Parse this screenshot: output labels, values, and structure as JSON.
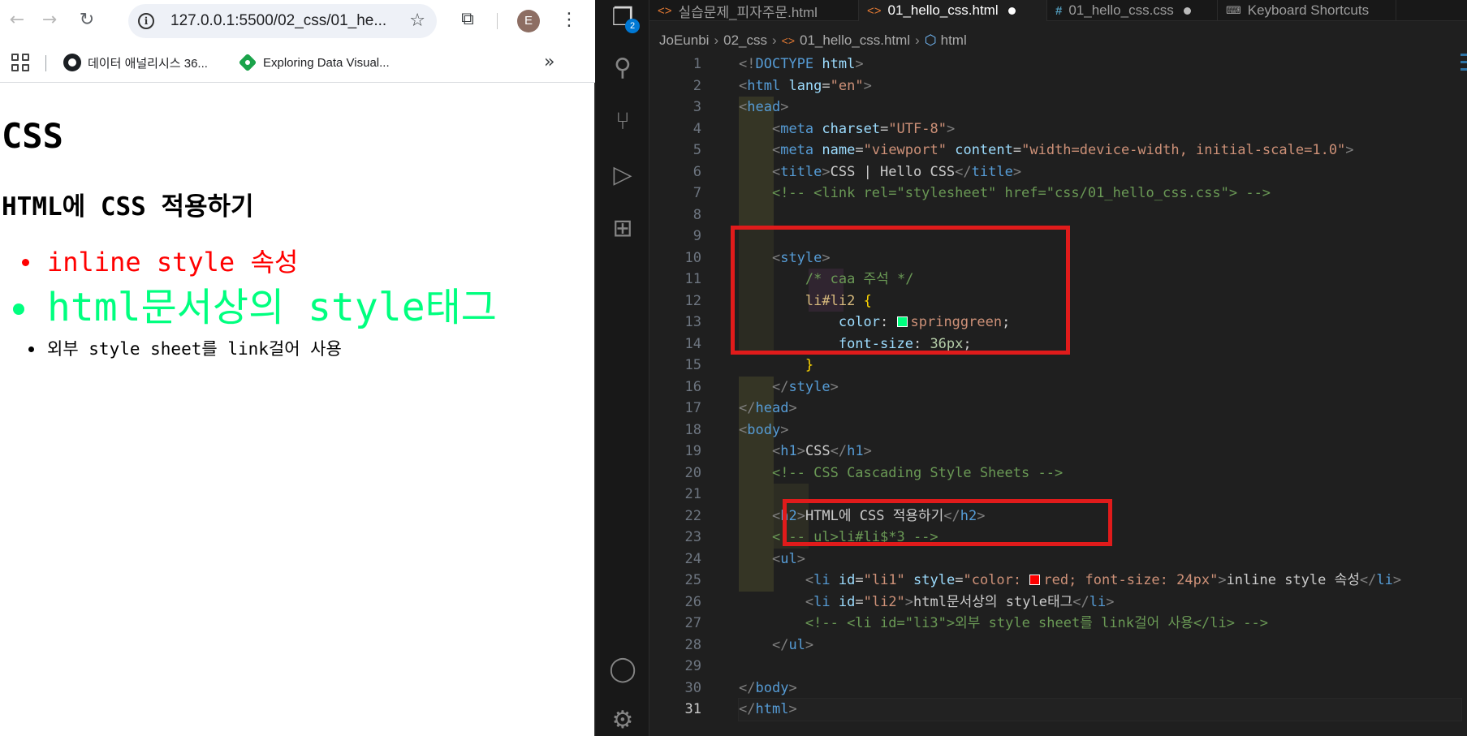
{
  "browser": {
    "url": "127.0.0.1:5500/02_css/01_he...",
    "avatar_letter": "E",
    "bookmarks": [
      {
        "label": "데이터 애널리시스 36...",
        "icon": "github-icon"
      },
      {
        "label": "Exploring Data Visual...",
        "icon": "datavis-icon"
      }
    ],
    "page": {
      "h1": "CSS",
      "h2": "HTML에 CSS 적용하기",
      "items": [
        {
          "text": "inline style 속성",
          "color": "#ff0000"
        },
        {
          "text": "html문서상의 style태그",
          "color": "#00ff7f"
        },
        {
          "text": "외부 style sheet를 link걸어 사용",
          "color": "#000000"
        }
      ]
    }
  },
  "vscode": {
    "tabs": [
      {
        "label": "실습문제_피자주문.html",
        "kind": "html",
        "active": false,
        "dirty": false
      },
      {
        "label": "01_hello_css.html",
        "kind": "html",
        "active": true,
        "dirty": true
      },
      {
        "label": "01_hello_css.css",
        "kind": "css",
        "active": false,
        "dirty": true
      },
      {
        "label": "Keyboard Shortcuts",
        "kind": "keyboard",
        "active": false,
        "dirty": false
      }
    ],
    "source_control_badge": "2",
    "breadcrumb": [
      "JoEunbi",
      "02_css",
      "01_hello_css.html",
      "html"
    ],
    "line_numbers": [
      "1",
      "2",
      "3",
      "4",
      "5",
      "6",
      "7",
      "8",
      "9",
      "10",
      "11",
      "12",
      "13",
      "14",
      "15",
      "16",
      "17",
      "18",
      "19",
      "20",
      "21",
      "22",
      "23",
      "24",
      "25",
      "26",
      "27",
      "28",
      "29",
      "30",
      "31"
    ],
    "current_line": "31",
    "code": {
      "l1_doctype": "DOCTYPE",
      "l1_html": "html",
      "l2_lang_val": "\"en\"",
      "l4_charset": "\"UTF-8\"",
      "l5_name": "\"viewport\"",
      "l5_content": "\"width=device-width, initial-scale=1.0\"",
      "l6_title": "CSS | Hello CSS",
      "l7_comment": "<!-- <link rel=\"stylesheet\" href=\"css/01_hello_css.css\"> -->",
      "l11_comment": "/* caa 주석 */",
      "l12_selector": "li#li2",
      "l13_prop": "color",
      "l13_value": "springgreen",
      "l13_swatch": "#00ff7f",
      "l14_prop": "font-size",
      "l14_value": "36px",
      "l19_text": "CSS",
      "l20_comment": "<!-- CSS Cascading Style Sheets -->",
      "l22_text": "HTML에 CSS 적용하기",
      "l23_comment": "<!-- ul>li#li$*3 -->",
      "l25_id": "\"li1\"",
      "l25_style_a": "\"color: ",
      "l25_style_b": "red; font-size: 24px\"",
      "l25_swatch": "#ff0000",
      "l25_text": "inline style 속성",
      "l26_id": "\"li2\"",
      "l26_text": "html문서상의 style태그",
      "l27_comment": "<!-- <li id=\"li3\">외부 style sheet를 link걸어 사용</li> -->"
    }
  }
}
